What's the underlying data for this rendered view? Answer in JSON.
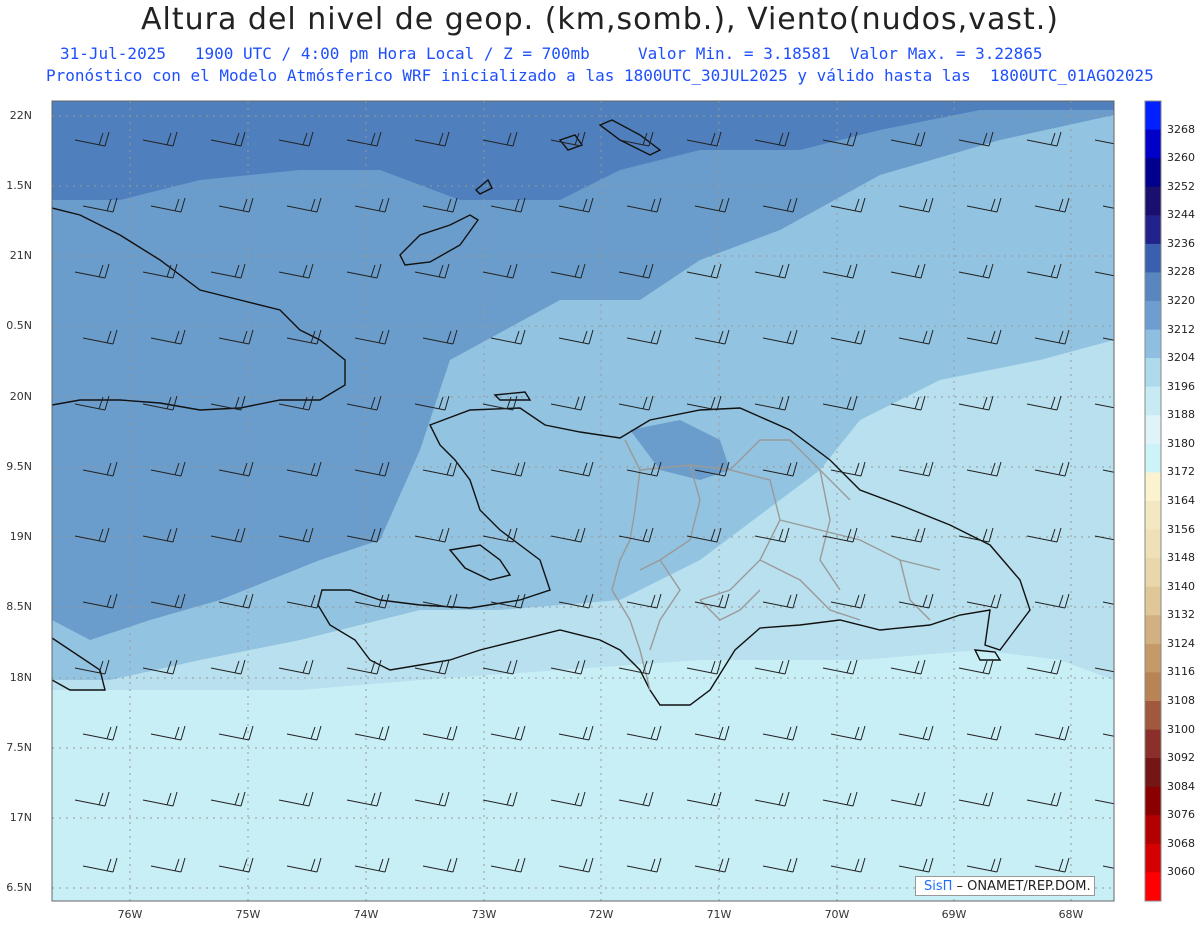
{
  "header": {
    "title": "Altura del nivel de geop. (km,somb.), Viento(nudos,vast.)",
    "line1": "31-Jul-2025   1900 UTC / 4:00 pm Hora Local / Z = 700mb     Valor Min. = 3.18581  Valor Max. = 3.22865",
    "line2": "Pronóstico con el Modelo Atmósferico WRF inicializado a las 1800UTC_30JUL2025 y válido hasta las  1800UTC_01AGO2025"
  },
  "axes": {
    "lat_labels": [
      "22N",
      "1.5N",
      "21N",
      "0.5N",
      "20N",
      "9.5N",
      "19N",
      "8.5N",
      "18N",
      "7.5N",
      "17N",
      "6.5N"
    ],
    "lon_labels": [
      "76W",
      "75W",
      "74W",
      "73W",
      "72W",
      "71W",
      "70W",
      "69W",
      "68W"
    ]
  },
  "colorbar": {
    "labels": [
      "3268",
      "3260",
      "3252",
      "3244",
      "3236",
      "3228",
      "3220",
      "3212",
      "3204",
      "3196",
      "3188",
      "3180",
      "3172",
      "3164",
      "3156",
      "3148",
      "3140",
      "3132",
      "3124",
      "3116",
      "3108",
      "3100",
      "3092",
      "3084",
      "3076",
      "3068",
      "3060"
    ],
    "colors": [
      "#0020ff",
      "#0000c8",
      "#00008c",
      "#1a0f6e",
      "#22238a",
      "#3a5fae",
      "#5a86c0",
      "#6e9ecf",
      "#8fbfe0",
      "#aedbeb",
      "#c8ebf3",
      "#dff3f8",
      "#ccf4f8",
      "#fbf3cf",
      "#f4e8c2",
      "#efe0b8",
      "#e9d6ab",
      "#e0c797",
      "#d3b081",
      "#c59968",
      "#b88456",
      "#a0593e",
      "#8a2f2a",
      "#741516",
      "#8a0000",
      "#b30000",
      "#d50000",
      "#ff0000"
    ]
  },
  "map": {
    "fill_bands": [
      "#4f7fbd",
      "#6b9dcc",
      "#92c3e0",
      "#b8e0ee",
      "#c8eef6"
    ]
  },
  "credit": {
    "brand": "SisΠ",
    "text": " – ONAMET/REP.DOM."
  }
}
